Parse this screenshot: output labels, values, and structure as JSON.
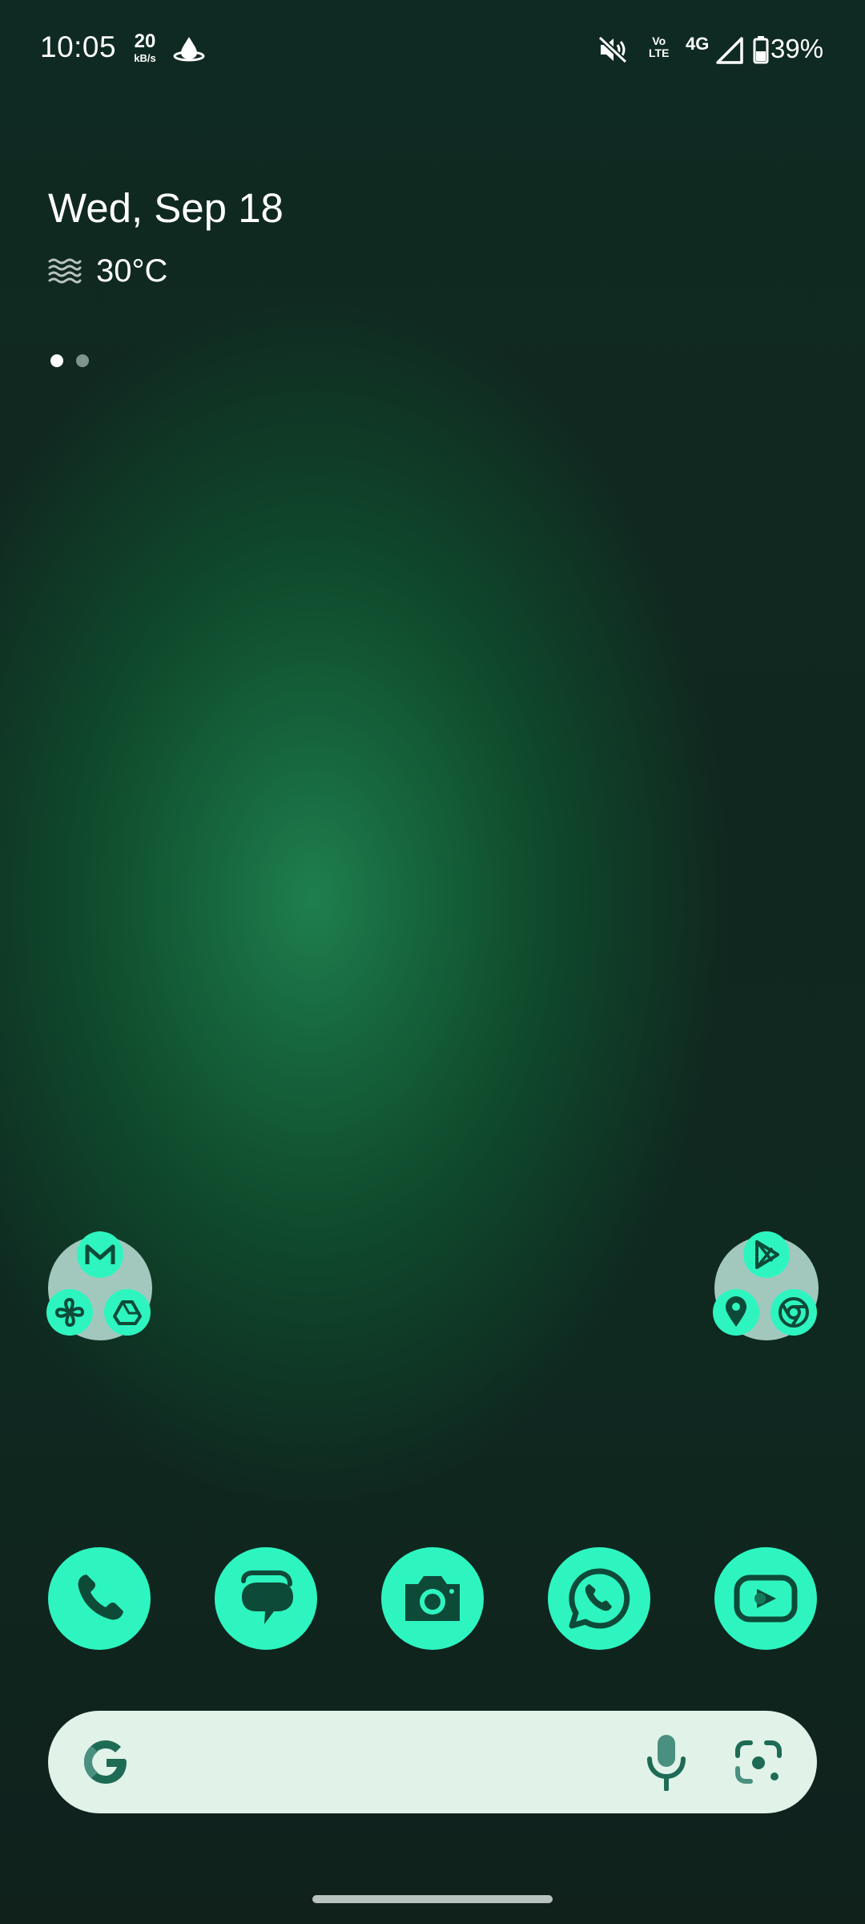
{
  "status_bar": {
    "time": "10:05",
    "net_speed_value": "20",
    "net_speed_unit": "kB/s",
    "volte_line1": "Vo",
    "volte_line2": "LTE",
    "network": "4G",
    "battery_percent": "39%",
    "icons": [
      "weather-drop-icon",
      "mute-icon",
      "volte-icon",
      "signal-icon",
      "battery-icon"
    ]
  },
  "glance": {
    "date": "Wed, Sep 18",
    "temperature": "30°C",
    "weather_icon": "haze-icon"
  },
  "pages": {
    "count": 2,
    "active": 0
  },
  "folders": [
    {
      "apps": [
        "gmail-icon",
        "pinwheel-icon",
        "drive-icon"
      ]
    },
    {
      "apps": [
        "play-store-icon",
        "maps-icon",
        "chrome-icon"
      ]
    }
  ],
  "dock": {
    "apps": [
      "phone-icon",
      "messages-icon",
      "camera-icon",
      "whatsapp-icon",
      "youtube-icon"
    ]
  },
  "search": {
    "icons": [
      "google-g-icon",
      "mic-icon",
      "lens-icon"
    ]
  },
  "colors": {
    "accent": "#2ef5c0",
    "icon_glyph": "#0e4a38",
    "folder_bg": "#a2c8bd",
    "search_bg": "#e1f2e8"
  }
}
